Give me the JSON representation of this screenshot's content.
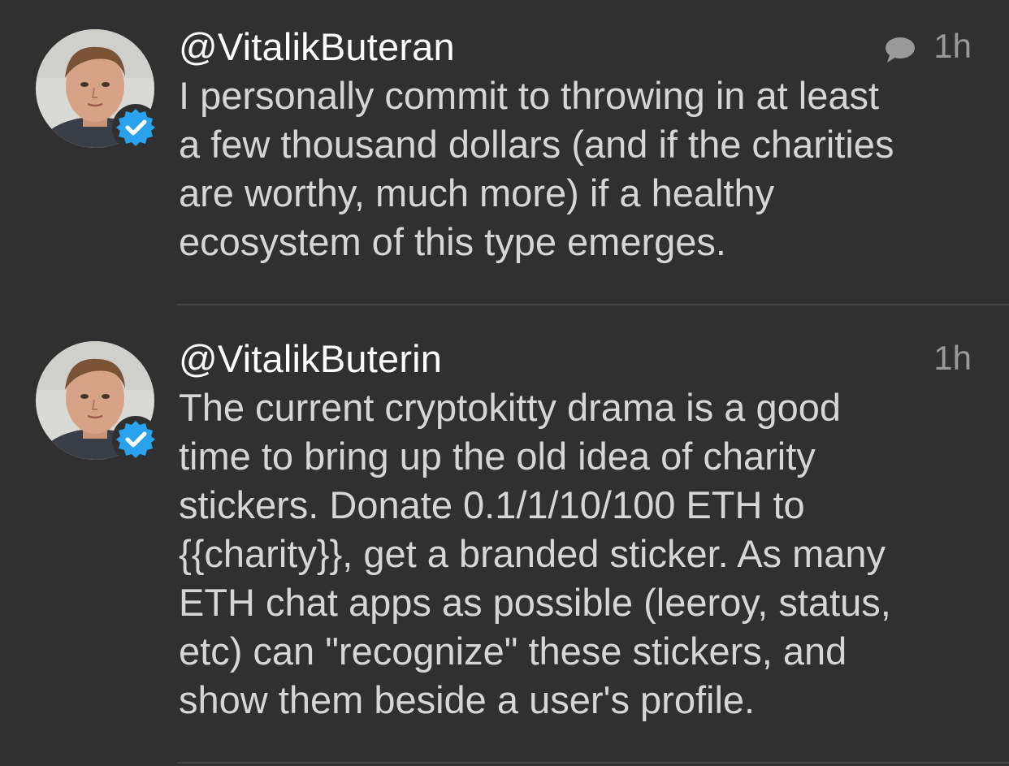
{
  "tweets": [
    {
      "handle": "@VitalikButeran",
      "time": "1h",
      "has_reply_icon": true,
      "verified": true,
      "text": "I personally commit to throwing in at least\na few thousand dollars (and if the charities\nare worthy, much more) if a healthy\necosystem of this type emerges."
    },
    {
      "handle": "@VitalikButerin",
      "time": "1h",
      "has_reply_icon": false,
      "verified": true,
      "text": "The current cryptokitty drama is a good\ntime to bring up the old idea of charity\nstickers. Donate 0.1/1/10/100 ETH to\n{{charity}}, get a branded sticker. As many\nETH chat apps as possible (leeroy, status,\netc) can \"recognize\" these stickers, and\nshow them beside a user's profile."
    }
  ],
  "icons": {
    "reply": "speech-bubble-icon",
    "verified": "verified-badge-icon"
  },
  "colors": {
    "background": "#303030",
    "handle": "#ffffff",
    "body_text": "#d6d6d6",
    "meta_text": "#9a9a9a",
    "verified_blue": "#2aa3ef",
    "separator": "#464646"
  }
}
